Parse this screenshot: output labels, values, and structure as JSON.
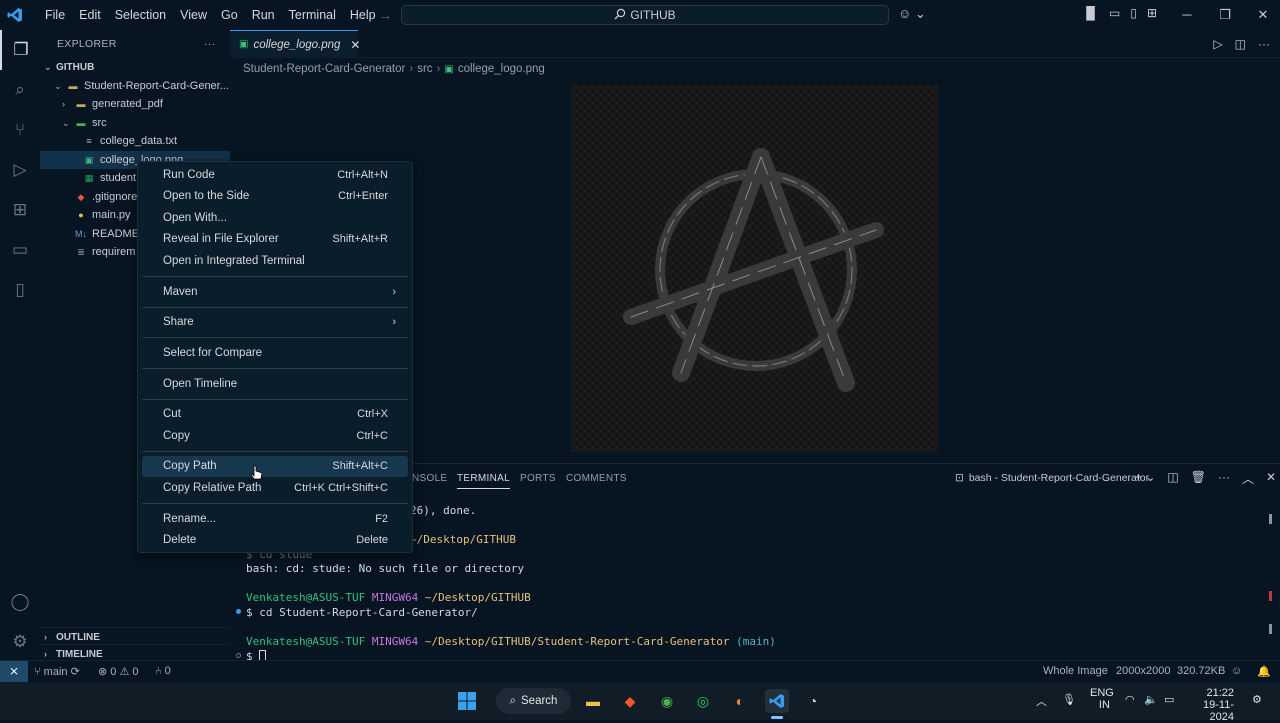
{
  "titlebar": {
    "menu": [
      "File",
      "Edit",
      "Selection",
      "View",
      "Go",
      "Run",
      "Terminal",
      "Help"
    ],
    "search": "GITHUB"
  },
  "sidebar": {
    "title": "EXPLORER",
    "root": "GITHUB",
    "items": [
      {
        "label": "Student-Report-Card-Gener...",
        "kind": "folder",
        "indent": 1,
        "open": true
      },
      {
        "label": "generated_pdf",
        "kind": "folder",
        "indent": 2,
        "open": false
      },
      {
        "label": "src",
        "kind": "folder-src",
        "indent": 2,
        "open": true
      },
      {
        "label": "college_data.txt",
        "kind": "txt",
        "indent": 3
      },
      {
        "label": "college_logo.png",
        "kind": "png",
        "indent": 3,
        "selected": true
      },
      {
        "label": "student",
        "kind": "xls",
        "indent": 3
      },
      {
        "label": ".gitignore",
        "kind": "git",
        "indent": 2
      },
      {
        "label": "main.py",
        "kind": "py",
        "indent": 2
      },
      {
        "label": "README.",
        "kind": "md",
        "indent": 2
      },
      {
        "label": "requirem",
        "kind": "req",
        "indent": 2
      }
    ],
    "outline": "OUTLINE",
    "timeline": "TIMELINE"
  },
  "editor": {
    "tab_label": "college_logo.png",
    "breadcrumb": [
      "Student-Report-Card-Generator",
      "src",
      "college_logo.png"
    ]
  },
  "panel": {
    "tabs": [
      "NSOLE",
      "TERMINAL",
      "PORTS",
      "COMMENTS"
    ],
    "terminal_name": "bash - Student-Report-Card-Generator",
    "lines": {
      "l1": "26), done.",
      "l2": "~/Desktop/GITHUB",
      "l3": "$ cd stude",
      "l4": "bash: cd: stude: No such file or directory",
      "l5_user": "Venkatesh@ASUS-TUF",
      "l5_sys": "MINGW64",
      "l5_path": "~/Desktop/GITHUB",
      "l6": "$ cd Student-Report-Card-Generator/",
      "l7_user": "Venkatesh@ASUS-TUF",
      "l7_sys": "MINGW64",
      "l7_path": "~/Desktop/GITHUB/Student-Report-Card-Generator",
      "l7_branch": "(main)",
      "l8": "$"
    }
  },
  "context_menu": {
    "items": [
      {
        "label": "Run Code",
        "kb": "Ctrl+Alt+N"
      },
      {
        "label": "Open to the Side",
        "kb": "Ctrl+Enter"
      },
      {
        "label": "Open With...",
        "kb": ""
      },
      {
        "label": "Reveal in File Explorer",
        "kb": "Shift+Alt+R"
      },
      {
        "label": "Open in Integrated Terminal",
        "kb": ""
      },
      {
        "label": "Maven",
        "submenu": true
      },
      {
        "label": "Share",
        "submenu": true
      },
      {
        "label": "Select for Compare",
        "kb": ""
      },
      {
        "label": "Open Timeline",
        "kb": ""
      },
      {
        "label": "Cut",
        "kb": "Ctrl+X"
      },
      {
        "label": "Copy",
        "kb": "Ctrl+C"
      },
      {
        "label": "Copy Path",
        "kb": "Shift+Alt+C",
        "hover": true
      },
      {
        "label": "Copy Relative Path",
        "kb": "Ctrl+K Ctrl+Shift+C"
      },
      {
        "label": "Rename...",
        "kb": "F2"
      },
      {
        "label": "Delete",
        "kb": "Delete"
      }
    ]
  },
  "statusbar": {
    "branch": "main",
    "errors": "0",
    "warnings": "0",
    "ports": "0",
    "view_mode": "Whole Image",
    "dimensions": "2000x2000",
    "filesize": "320.72KB"
  },
  "taskbar": {
    "search": "Search",
    "lang": "ENG",
    "region": "IN",
    "time": "21:22",
    "date": "19-11-2024"
  },
  "colors": {
    "accent": "#3a9cf0",
    "background": "#061521",
    "terminal_user": "#2ec27e",
    "terminal_sys": "#c678dd",
    "terminal_path": "#e5c07b"
  }
}
